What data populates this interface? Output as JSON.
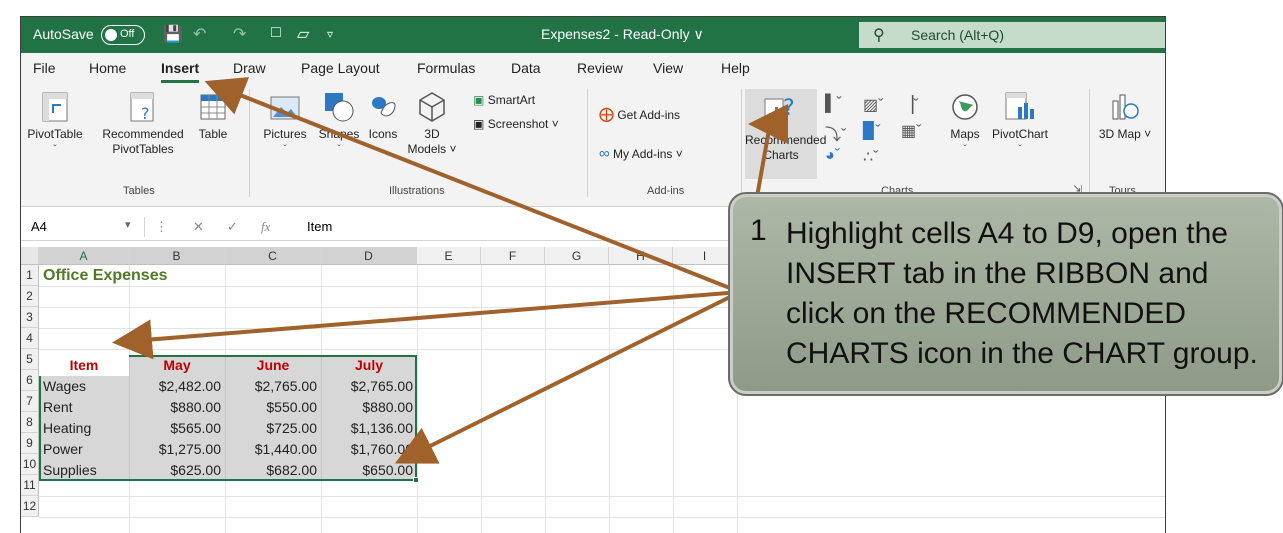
{
  "titlebar": {
    "autosave_label": "AutoSave",
    "autosave_state": "Off",
    "document_title": "Expenses2  -  Read-Only ∨",
    "search_placeholder": "Search (Alt+Q)"
  },
  "tabs": [
    "File",
    "Home",
    "Insert",
    "Draw",
    "Page Layout",
    "Formulas",
    "Data",
    "Review",
    "View",
    "Help"
  ],
  "active_tab": "Insert",
  "ribbon": {
    "pivottable": "PivotTable",
    "recommended_pivottables": "Recommended PivotTables",
    "table": "Table",
    "pictures": "Pictures",
    "shapes": "Shapes",
    "icons": "Icons",
    "models_3d": "3D Models ˅",
    "smartart": "SmartArt",
    "screenshot": "Screenshot ˅",
    "get_addins": "Get Add-ins",
    "my_addins": "My Add-ins ˅",
    "recommended_charts": "Recommended Charts",
    "maps": "Maps",
    "pivotchart": "PivotChart",
    "map_3d": "3D Map ˅",
    "groups": {
      "tables": "Tables",
      "illustrations": "Illustrations",
      "addins": "Add-ins",
      "charts": "Charts",
      "tours": "Tours"
    }
  },
  "formula_bar": {
    "name_box": "A4",
    "content": "Item"
  },
  "sheet": {
    "columns": [
      "A",
      "B",
      "C",
      "D",
      "E",
      "F",
      "G",
      "H",
      "I"
    ],
    "rows": [
      "1",
      "2",
      "3",
      "4",
      "5",
      "6",
      "7",
      "8",
      "9",
      "10",
      "11",
      "12"
    ],
    "title": "Office Expenses",
    "headers": [
      "Item",
      "May",
      "June",
      "July"
    ],
    "data": [
      [
        "Wages",
        "$2,482.00",
        "$2,765.00",
        "$2,765.00"
      ],
      [
        "Rent",
        "$880.00",
        "$550.00",
        "$880.00"
      ],
      [
        "Heating",
        "$565.00",
        "$725.00",
        "$1,136.00"
      ],
      [
        "Power",
        "$1,275.00",
        "$1,440.00",
        "$1,760.00"
      ],
      [
        "Supplies",
        "$625.00",
        "$682.00",
        "$650.00"
      ]
    ]
  },
  "callout": {
    "step": "1",
    "text": "Highlight cells A4 to D9, open the INSERT tab in the RIBBON and click on the RECOMMENDED CHARTS icon in the CHART group."
  },
  "colors": {
    "excel_green": "#217346",
    "header_red": "#c00000",
    "arrow_brown": "#a0612a",
    "callout_green": "#9ea897"
  }
}
